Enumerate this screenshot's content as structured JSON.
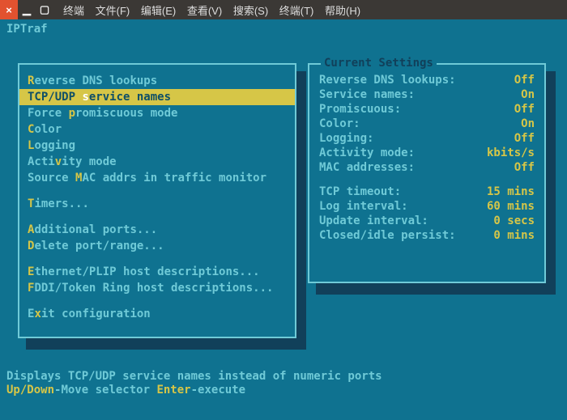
{
  "window": {
    "menus": [
      "终端",
      "文件(F)",
      "编辑(E)",
      "查看(V)",
      "搜索(S)",
      "终端(T)",
      "帮助(H)"
    ]
  },
  "app_title": "IPTraf",
  "menu": {
    "items": [
      {
        "hot": "R",
        "rest": "everse DNS lookups"
      },
      {
        "pre": "TCP/UDP ",
        "hot": "s",
        "rest": "ervice names",
        "selected": true
      },
      {
        "pre": "Force ",
        "hot": "p",
        "rest": "romiscuous mode"
      },
      {
        "hot": "C",
        "rest": "olor"
      },
      {
        "hot": "L",
        "rest": "ogging"
      },
      {
        "pre": "Acti",
        "hot": "v",
        "rest": "ity mode"
      },
      {
        "pre": "Source ",
        "hot": "M",
        "rest": "AC addrs in traffic monitor"
      }
    ],
    "timers": {
      "hot": "T",
      "rest": "imers..."
    },
    "ports": [
      {
        "hot": "A",
        "rest": "dditional ports..."
      },
      {
        "hot": "D",
        "rest": "elete port/range..."
      }
    ],
    "hosts": [
      {
        "hot": "E",
        "rest": "thernet/PLIP host descriptions..."
      },
      {
        "hot": "F",
        "rest": "DDI/Token Ring host descriptions..."
      }
    ],
    "exit": {
      "pre": "E",
      "hot": "x",
      "rest": "it configuration"
    }
  },
  "settings": {
    "legend": "Current Settings",
    "rows1": [
      {
        "label": "Reverse DNS lookups:",
        "val": "Off"
      },
      {
        "label": "Service names:",
        "val": "On"
      },
      {
        "label": "Promiscuous:",
        "val": "Off"
      },
      {
        "label": "Color:",
        "val": "On"
      },
      {
        "label": "Logging:",
        "val": "Off"
      },
      {
        "label": "Activity mode:",
        "val": "kbits/s"
      },
      {
        "label": "MAC addresses:",
        "val": "Off"
      }
    ],
    "rows2": [
      {
        "label": "TCP timeout:",
        "val": "15 mins"
      },
      {
        "label": "Log interval:",
        "val": "60 mins"
      },
      {
        "label": "Update interval:",
        "val": "0 secs"
      },
      {
        "label": "Closed/idle persist:",
        "val": "0 mins"
      }
    ]
  },
  "footer": {
    "desc": "Displays TCP/UDP service names instead of numeric ports",
    "help": [
      {
        "key": "Up/Down",
        "txt": "-Move selector  "
      },
      {
        "key": "Enter",
        "txt": "-execute"
      }
    ]
  }
}
